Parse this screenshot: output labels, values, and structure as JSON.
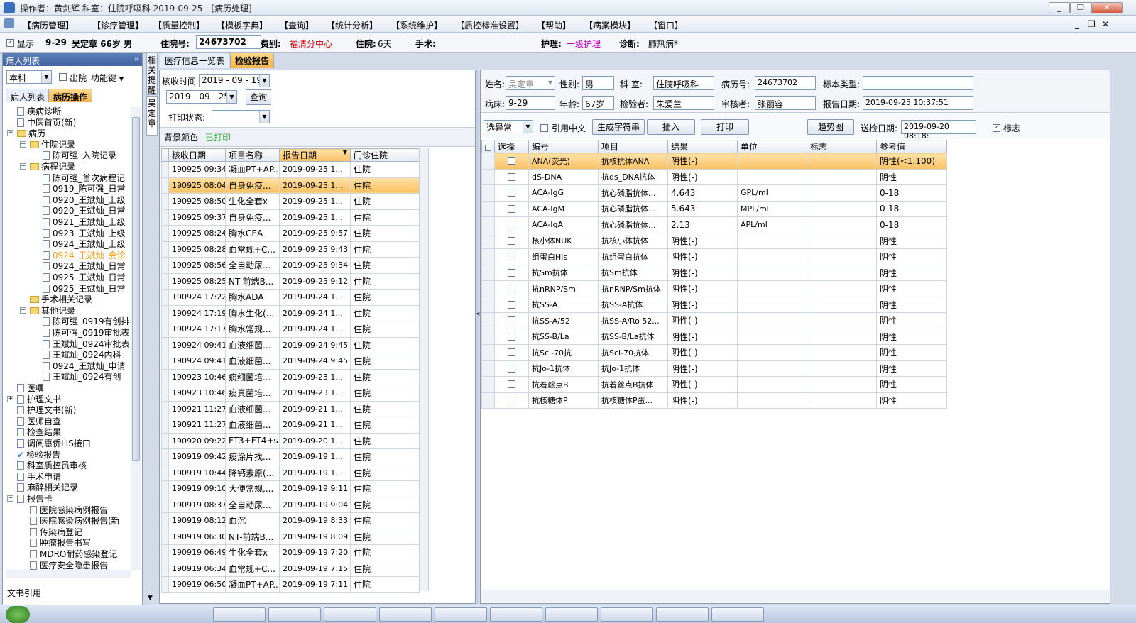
{
  "window": {
    "title": "操作者：黄剑辉  科室：住院呼吸科  2019-09-25 - [病历处理]"
  },
  "menu": [
    "【病历管理】",
    "【诊疗管理】",
    "【质量控制】",
    "【模板字典】",
    "【查询】",
    "【统计分析】",
    "【系统维护】",
    "【质控标准设置】",
    "【帮助】",
    "【病案模块】",
    "【窗口】"
  ],
  "patient": {
    "show_label": "显示",
    "bed": "9-29",
    "name_age": "吴定章 66岁 男",
    "inpatient_label": "住院号:",
    "inpatient_no": "24673702",
    "fee_label": "费别:",
    "fee": "福清分中心",
    "stay_label": "住院:",
    "stay": "6天",
    "surgery_label": "手术:",
    "nursing_label": "护理:",
    "nursing": "一级护理",
    "diag_label": "诊断:",
    "diag": "肺热病*"
  },
  "left": {
    "title": "病人列表",
    "pin": "ᵖ",
    "dept": "本科",
    "discharge_label": "出院",
    "func_label": "功能键",
    "tab1": "病人列表",
    "tab2": "病历操作",
    "bottom": "文书引用",
    "tree": [
      {
        "t": "疾病诊断",
        "lv": 1,
        "i": "doc"
      },
      {
        "t": "中医首页(新)",
        "lv": 1,
        "i": "doc"
      },
      {
        "t": "病历",
        "lv": 1,
        "i": "folder",
        "exp": "−"
      },
      {
        "t": "住院记录",
        "lv": 2,
        "i": "folder",
        "exp": "−"
      },
      {
        "t": "陈可强_入院记录",
        "lv": 3,
        "i": "doc"
      },
      {
        "t": "病程记录",
        "lv": 2,
        "i": "folder",
        "exp": "−"
      },
      {
        "t": "陈可强_首次病程记",
        "lv": 3,
        "i": "doc"
      },
      {
        "t": "0919_陈可强_日常",
        "lv": 3,
        "i": "doc"
      },
      {
        "t": "0920_王斌灿_上级",
        "lv": 3,
        "i": "doc"
      },
      {
        "t": "0920_王斌灿_日常",
        "lv": 3,
        "i": "doc"
      },
      {
        "t": "0921_王斌灿_上级",
        "lv": 3,
        "i": "doc"
      },
      {
        "t": "0923_王斌灿_上级",
        "lv": 3,
        "i": "doc"
      },
      {
        "t": "0924_王斌灿_上级",
        "lv": 3,
        "i": "doc"
      },
      {
        "t": "0924_王斌灿_会诊",
        "lv": 3,
        "i": "doc",
        "hl": true
      },
      {
        "t": "0924_王斌灿_日常",
        "lv": 3,
        "i": "doc"
      },
      {
        "t": "0925_王斌灿_日常",
        "lv": 3,
        "i": "doc"
      },
      {
        "t": "0925_王斌灿_日常",
        "lv": 3,
        "i": "doc"
      },
      {
        "t": "手术相关记录",
        "lv": 2,
        "i": "folder"
      },
      {
        "t": "其他记录",
        "lv": 2,
        "i": "folder",
        "exp": "−"
      },
      {
        "t": "陈可强_0919有创排",
        "lv": 3,
        "i": "doc"
      },
      {
        "t": "陈可强_0919审批表",
        "lv": 3,
        "i": "doc"
      },
      {
        "t": "王斌灿_0924审批表",
        "lv": 3,
        "i": "doc"
      },
      {
        "t": "王斌灿_0924内科",
        "lv": 3,
        "i": "doc"
      },
      {
        "t": "0924_王斌灿_申请",
        "lv": 3,
        "i": "doc"
      },
      {
        "t": "王斌灿_0924有创",
        "lv": 3,
        "i": "doc"
      },
      {
        "t": "医嘱",
        "lv": 1,
        "i": "doc"
      },
      {
        "t": "护理文书",
        "lv": 1,
        "i": "doc",
        "exp": "+"
      },
      {
        "t": "护理文书(新)",
        "lv": 1,
        "i": "doc"
      },
      {
        "t": "医师自查",
        "lv": 1,
        "i": "doc"
      },
      {
        "t": "检查结果",
        "lv": 1,
        "i": "doc"
      },
      {
        "t": "调阅惠侨LIS接口",
        "lv": 1,
        "i": "doc"
      },
      {
        "t": "检验报告",
        "lv": 1,
        "i": "check"
      },
      {
        "t": "科室质控员审核",
        "lv": 1,
        "i": "doc"
      },
      {
        "t": "手术申请",
        "lv": 1,
        "i": "doc"
      },
      {
        "t": "麻醉相关记录",
        "lv": 1,
        "i": "doc"
      },
      {
        "t": "报告卡",
        "lv": 1,
        "i": "doc",
        "exp": "−"
      },
      {
        "t": "医院感染病例报告",
        "lv": 2,
        "i": "doc"
      },
      {
        "t": "医院感染病例报告(新",
        "lv": 2,
        "i": "doc"
      },
      {
        "t": "传染病登记",
        "lv": 2,
        "i": "doc"
      },
      {
        "t": "肿瘤报告书写",
        "lv": 2,
        "i": "doc"
      },
      {
        "t": "MDRO耐药感染登记",
        "lv": 2,
        "i": "doc"
      },
      {
        "t": "医疗安全隐患报告",
        "lv": 2,
        "i": "doc"
      }
    ]
  },
  "side_tabs": [
    "相关提醒",
    "吴定章"
  ],
  "tabs": [
    "医疗信息一览表",
    "检验报告"
  ],
  "filter": {
    "recv_label": "核收时间",
    "date1": "2019 - 09 - 19",
    "date2": "2019 - 09 - 25",
    "query": "查询",
    "print_label": "打印状态:",
    "bg_label": "背景颜色",
    "printed": "已打印"
  },
  "list": {
    "headers": [
      "核收日期",
      "项目名称",
      "报告日期",
      "门诊住院"
    ],
    "rows": [
      [
        "190925 09:34",
        "凝血PT+AP...",
        "2019-09-25 1...",
        "住院"
      ],
      [
        "190925 08:04",
        "自身免疫...",
        "2019-09-25 1...",
        "住院"
      ],
      [
        "190925 08:50",
        "生化全套x",
        "2019-09-25 1...",
        "住院"
      ],
      [
        "190925 09:37",
        "自身免疫...",
        "2019-09-25 1...",
        "住院"
      ],
      [
        "190925 08:24",
        "胸水CEA",
        "2019-09-25 9:57",
        "住院"
      ],
      [
        "190925 08:28",
        "血常规+C...",
        "2019-09-25 9:43",
        "住院"
      ],
      [
        "190925 08:56",
        "全自动尿...",
        "2019-09-25 9:34",
        "住院"
      ],
      [
        "190925 08:25",
        "NT-前端B...",
        "2019-09-25 9:12",
        "住院"
      ],
      [
        "190924 17:22",
        "胸水ADA",
        "2019-09-24 1...",
        "住院"
      ],
      [
        "190924 17:19",
        "胸水生化(...",
        "2019-09-24 1...",
        "住院"
      ],
      [
        "190924 17:17",
        "胸水常规...",
        "2019-09-24 1...",
        "住院"
      ],
      [
        "190924 09:41",
        "血液细菌...",
        "2019-09-24 9:45",
        "住院"
      ],
      [
        "190924 09:41",
        "血液细菌...",
        "2019-09-24 9:45",
        "住院"
      ],
      [
        "190923 10:46",
        "痰细菌培...",
        "2019-09-23 1...",
        "住院"
      ],
      [
        "190923 10:46",
        "痰真菌培...",
        "2019-09-23 1...",
        "住院"
      ],
      [
        "190921 11:27",
        "血液细菌...",
        "2019-09-21 1...",
        "住院"
      ],
      [
        "190921 11:27",
        "血液细菌...",
        "2019-09-21 1...",
        "住院"
      ],
      [
        "190920 09:22",
        "FT3+FT4+s...",
        "2019-09-20 1...",
        "住院"
      ],
      [
        "190919 09:42",
        "痰涂片找...",
        "2019-09-19 1...",
        "住院"
      ],
      [
        "190919 10:44",
        "降钙素原(...",
        "2019-09-19 1...",
        "住院"
      ],
      [
        "190919 09:10",
        "大便常规,...",
        "2019-09-19 9:11",
        "住院"
      ],
      [
        "190919 08:37",
        "全自动尿...",
        "2019-09-19 9:04",
        "住院"
      ],
      [
        "190919 08:12",
        "血沉",
        "2019-09-19 8:33",
        "住院"
      ],
      [
        "190919 06:30",
        "NT-前端B...",
        "2019-09-19 8:09",
        "住院"
      ],
      [
        "190919 06:49",
        "生化全套x",
        "2019-09-19 7:20",
        "住院"
      ],
      [
        "190919 06:34",
        "血常规+C...",
        "2019-09-19 7:15",
        "住院"
      ],
      [
        "190919 06:50",
        "凝血PT+AP...",
        "2019-09-19 7:11",
        "住院"
      ]
    ]
  },
  "report": {
    "name_label": "姓名:",
    "name": "吴定章",
    "sex_label": "性别:",
    "sex": "男",
    "dept_label": "科  室:",
    "dept": "住院呼吸科",
    "recno_label": "病历号:",
    "recno": "24673702",
    "spec_label": "标本类型:",
    "spec": "",
    "bed_label": "病床:",
    "bed": "9-29",
    "age_label": "年龄:",
    "age": "67岁",
    "tester_label": "检验者:",
    "tester": "朱爱兰",
    "reviewer_label": "审核者:",
    "reviewer": "张丽容",
    "date_label": "报告日期:",
    "date": "2019-09-25 10:37:51",
    "abn_select": "选异常",
    "cite_cn": "引用中文",
    "gen_str": "生成字符串",
    "insert": "插入",
    "print": "打印",
    "trend": "趋势图",
    "send_label": "送检日期:",
    "send_date": "2019-09-20 08:18:",
    "flag_label": "标志"
  },
  "results": {
    "headers": [
      "选择",
      "编号",
      "项目",
      "结果",
      "单位",
      "标志",
      "参考值"
    ],
    "rows": [
      [
        "ANA(荧光)",
        "抗核抗体ANA",
        "阴性(-)",
        "",
        "",
        "阴性(<1:100)"
      ],
      [
        "dS-DNA",
        "抗ds_DNA抗体",
        "阴性(-)",
        "",
        "",
        "阴性"
      ],
      [
        "ACA-IgG",
        "抗心磷脂抗体...",
        "4.643",
        "GPL/ml",
        "",
        "0-18"
      ],
      [
        "ACA-IgM",
        "抗心磷脂抗体...",
        "5.643",
        "MPL/ml",
        "",
        "0-18"
      ],
      [
        "ACA-IgA",
        "抗心磷脂抗体...",
        "2.13",
        "APL/ml",
        "",
        "0-18"
      ],
      [
        "核小体NUK",
        "抗核小体抗体",
        "阴性(-)",
        "",
        "",
        "阴性"
      ],
      [
        "组蛋白His",
        "抗组蛋白抗体",
        "阴性(-)",
        "",
        "",
        "阴性"
      ],
      [
        "抗Sm抗体",
        "抗Sm抗体",
        "阴性(-)",
        "",
        "",
        "阴性"
      ],
      [
        "抗nRNP/Sm",
        "抗nRNP/Sm抗体",
        "阴性(-)",
        "",
        "",
        "阴性"
      ],
      [
        "抗SS-A",
        "抗SS-A抗体",
        "阴性(-)",
        "",
        "",
        "阴性"
      ],
      [
        "抗SS-A/52",
        "抗SS-A/Ro 52...",
        "阴性(-)",
        "",
        "",
        "阴性"
      ],
      [
        "抗SS-B/La",
        "抗SS-B/La抗体",
        "阴性(-)",
        "",
        "",
        "阴性"
      ],
      [
        "抗Scl-70抗",
        "抗Scl-70抗体",
        "阴性(-)",
        "",
        "",
        "阴性"
      ],
      [
        "抗Jo-1抗体",
        "抗Jo-1抗体",
        "阴性(-)",
        "",
        "",
        "阴性"
      ],
      [
        "抗着丝点B",
        "抗着丝点B抗体",
        "阴性(-)",
        "",
        "",
        "阴性"
      ],
      [
        "抗核糖体P",
        "抗核糖体P蛋...",
        "阴性(-)",
        "",
        "",
        "阴性"
      ]
    ]
  },
  "colors": {
    "accent": "#f9c163",
    "fee": "#d00000",
    "nursing": "#c000c0",
    "printed": "#3cb043",
    "highlight": "#f39c12"
  }
}
